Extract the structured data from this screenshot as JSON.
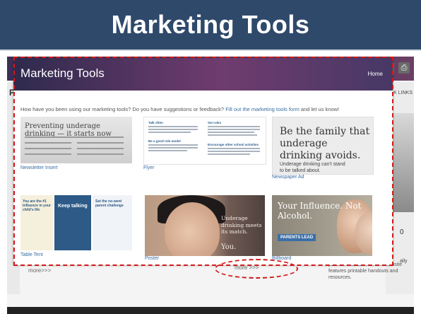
{
  "slide": {
    "title": "Marketing Tools"
  },
  "background_site": {
    "links_label": "K LINKS",
    "left_initial": "P",
    "icons": [
      "share-icon",
      "print-icon"
    ],
    "more_left": "more>>>",
    "more_center": "more >>>",
    "right_number": "0",
    "side_text": "ally",
    "description": "parents and families. The website features printable handouts and resources."
  },
  "panel": {
    "title": "Marketing Tools",
    "nav_home": "Home",
    "intro_text": "How have you been using our marketing tools? Do you have suggestions or feedback?",
    "intro_link": "Fill out the marketing tools form",
    "intro_tail": "and let us know!"
  },
  "cards": [
    {
      "caption": "Newsletter Insert",
      "headline": "Preventing underage drinking — it starts now"
    },
    {
      "caption": "Flyer",
      "headings": [
        "Talk often",
        "Be a good role model",
        "Set rules",
        "Encourage other school activities"
      ]
    },
    {
      "caption": "Newspaper Ad",
      "headline": "Be the family that underage drinking avoids.",
      "subhead": "Underage drinking can't stand to be talked about."
    },
    {
      "caption": "Table Tent",
      "panels": [
        "You are the #1 influence in your child's life",
        "Keep talking",
        "Set the no-went parent challenge"
      ]
    },
    {
      "caption": "Poster",
      "text": "Underage drinking meets its match.",
      "tag": "You."
    },
    {
      "caption": "Billboard",
      "headline": "Your Influence. Not Alcohol.",
      "badge": "PARENTS LEAD"
    }
  ],
  "colors": {
    "title_bar": "#2f496b",
    "annotation": "#d11a1a",
    "link": "#3a6ea5"
  }
}
